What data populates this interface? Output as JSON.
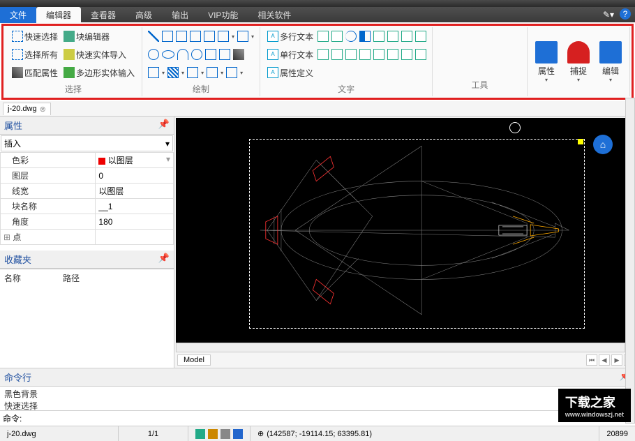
{
  "menubar": {
    "file": "文件",
    "editor": "编辑器",
    "viewer": "查看器",
    "advanced": "高级",
    "output": "输出",
    "vip": "VIP功能",
    "related": "相关软件"
  },
  "ribbon": {
    "select_group": "选择",
    "quick_select": "快速选择",
    "select_all": "选择所有",
    "match_props": "匹配属性",
    "block_editor": "块编辑器",
    "quick_entity_import": "快速实体导入",
    "polygon_entity_input": "多边形实体输入",
    "draw_group": "绘制",
    "text_group": "文字",
    "mtext": "多行文本",
    "stext": "单行文本",
    "attdef": "属性定义",
    "tools_group": "工具",
    "props_btn": "属性",
    "snap_btn": "捕捉",
    "edit_btn": "编辑"
  },
  "file_tab": "j-20.dwg",
  "panels": {
    "properties": "属性",
    "insert": "插入",
    "favorites": "收藏夹",
    "cmdline": "命令行",
    "fav_name": "名称",
    "fav_path": "路径"
  },
  "props": {
    "color_label": "色彩",
    "color_val": "以图层",
    "layer_label": "图层",
    "layer_val": "0",
    "lw_label": "线宽",
    "lw_val": "以图层",
    "block_label": "块名称",
    "block_val": "__1",
    "angle_label": "角度",
    "angle_val": "180",
    "point_label": "点"
  },
  "model_tab": "Model",
  "cmd": {
    "history1": "黑色背景",
    "history2": "快速选择",
    "prompt": "命令:"
  },
  "status": {
    "file": "j-20.dwg",
    "page": "1/1",
    "coords": "(142587; -19114.15; 63395.81)",
    "right": "20899"
  },
  "watermark": {
    "title": "下载之家",
    "url": "www.windowszj.net"
  }
}
